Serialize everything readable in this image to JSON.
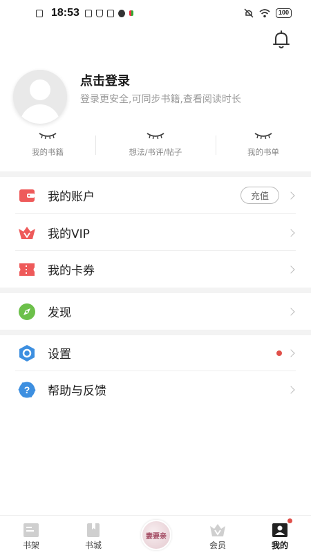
{
  "status_bar": {
    "time": "18:53",
    "battery": "100"
  },
  "profile": {
    "title": "点击登录",
    "subtitle": "登录更安全,可同步书籍,查看阅读时长"
  },
  "stats": [
    {
      "value": "˘˘˘˘",
      "label": "我的书籍"
    },
    {
      "value": "˘˘˘˘",
      "label": "想法/书评/帖子"
    },
    {
      "value": "˘˘˘˘",
      "label": "我的书单"
    }
  ],
  "menu": {
    "account": {
      "label": "我的账户",
      "action": "充值",
      "icon": "wallet-icon",
      "color": "#ee5a5a"
    },
    "vip": {
      "label": "我的VIP",
      "icon": "crown-icon",
      "color": "#ee5a5a"
    },
    "coupons": {
      "label": "我的卡券",
      "icon": "ticket-icon",
      "color": "#ee5a5a"
    },
    "discover": {
      "label": "发现",
      "icon": "compass-icon",
      "color": "#6cc04a"
    },
    "settings": {
      "label": "设置",
      "icon": "gear-hexagon-icon",
      "color": "#3d8fe0"
    },
    "help": {
      "label": "帮助与反馈",
      "icon": "question-icon",
      "color": "#3d8fe0"
    }
  },
  "bottom_nav": {
    "bookshelf": "书架",
    "bookstore": "书城",
    "center_book": "妻要亲",
    "member": "会员",
    "mine": "我的"
  }
}
